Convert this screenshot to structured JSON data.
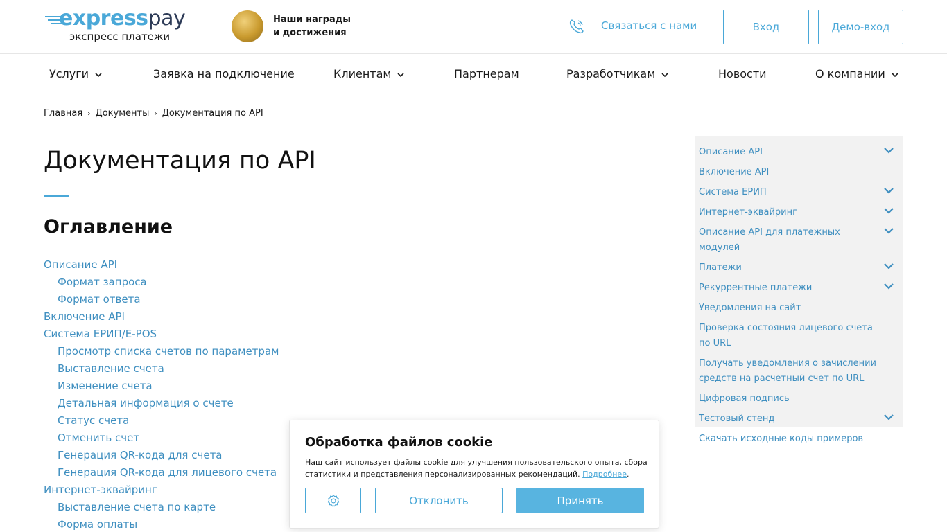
{
  "header": {
    "logo_express": "express",
    "logo_pay": "pay",
    "logo_sub": "экспресс платежи",
    "award_line1": "Наши награды",
    "award_line2": "и достижения",
    "contact": "Связаться с нами",
    "login": "Вход",
    "demo": "Демо-вход"
  },
  "nav": {
    "items": [
      {
        "label": "Услуги",
        "dropdown": true
      },
      {
        "label": "Заявка на подключение",
        "dropdown": false
      },
      {
        "label": "Клиентам",
        "dropdown": true
      },
      {
        "label": "Партнерам",
        "dropdown": false
      },
      {
        "label": "Разработчикам",
        "dropdown": true
      },
      {
        "label": "Новости",
        "dropdown": false
      },
      {
        "label": "О компании",
        "dropdown": true
      }
    ]
  },
  "breadcrumb": [
    "Главная",
    "Документы",
    "Документация по API"
  ],
  "main": {
    "title": "Документация по API",
    "toc_heading": "Оглавление",
    "toc": [
      {
        "label": "Описание API",
        "level": 0
      },
      {
        "label": "Формат запроса",
        "level": 1
      },
      {
        "label": "Формат ответа",
        "level": 1
      },
      {
        "label": "Включение API",
        "level": 0
      },
      {
        "label": "Система ЕРИП/E-POS",
        "level": 0
      },
      {
        "label": "Просмотр списка счетов по параметрам",
        "level": 1
      },
      {
        "label": "Выставление счета",
        "level": 1
      },
      {
        "label": "Изменение счета",
        "level": 1
      },
      {
        "label": "Детальная информация о счете",
        "level": 1
      },
      {
        "label": "Статус счета",
        "level": 1
      },
      {
        "label": "Отменить счет",
        "level": 1
      },
      {
        "label": "Генерация QR-кода для счета",
        "level": 1
      },
      {
        "label": "Генерация QR-кода для лицевого счета",
        "level": 1
      },
      {
        "label": "Интернет-эквайринг",
        "level": 0
      },
      {
        "label": "Выставление счета по карте",
        "level": 1
      },
      {
        "label": "Форма оплаты",
        "level": 1
      }
    ]
  },
  "sidebar": {
    "items": [
      {
        "label": "Описание API",
        "expandable": true
      },
      {
        "label": "Включение API",
        "expandable": false
      },
      {
        "label": "Система ЕРИП",
        "expandable": true
      },
      {
        "label": "Интернет-эквайринг",
        "expandable": true
      },
      {
        "label": "Описание API для платежных модулей",
        "expandable": true
      },
      {
        "label": "Платежи",
        "expandable": true
      },
      {
        "label": "Рекуррентные платежи",
        "expandable": true
      },
      {
        "label": "Уведомления на сайт",
        "expandable": false
      },
      {
        "label": "Проверка состояния лицевого счета по URL",
        "expandable": false
      },
      {
        "label": "Получать уведомления о зачислении средств на расчетный счет по URL",
        "expandable": false
      },
      {
        "label": "Цифровая подпись",
        "expandable": false
      },
      {
        "label": "Тестовый стенд",
        "expandable": true
      },
      {
        "label": "Скачать исходные коды примеров",
        "expandable": false
      }
    ]
  },
  "cookie": {
    "title": "Обработка файлов cookie",
    "text": "Наш сайт использует файлы cookie для улучшения пользовательского опыта, сбора статистики и представления персонализированных рекомендаций.",
    "more": "Подробнее",
    "decline": "Отклонить",
    "accept": "Принять"
  },
  "colors": {
    "accent": "#4aa8d8",
    "link": "#3f8fc0",
    "brand_dark": "#2d3b57"
  },
  "icons": {
    "phone": "phone-icon",
    "chevron": "chevron-down-icon",
    "settings": "gear-icon",
    "medal": "award-medal-icon"
  }
}
